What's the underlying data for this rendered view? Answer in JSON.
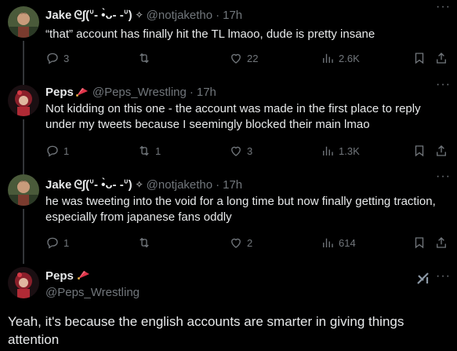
{
  "tweets": [
    {
      "name": "Jake",
      "name_deco": "ᘓ∫(ᐡ- •̀ᴗ- -ᐡ)",
      "badge": "✧",
      "handle": "@notjaketho",
      "time": "17h",
      "text": "“that” account has finally hit the TL lmaoo, dude is pretty insane",
      "replies": "3",
      "retweets": "",
      "likes": "22",
      "views": "2.6K"
    },
    {
      "name": "Peps",
      "name_deco": "",
      "badge": "",
      "handle": "@Peps_Wrestling",
      "time": "17h",
      "text": "Not kidding on this one - the account was made in the first place to reply under my tweets because I seemingly blocked their main lmao",
      "replies": "1",
      "retweets": "1",
      "likes": "3",
      "views": "1.3K"
    },
    {
      "name": "Jake",
      "name_deco": "ᘓ∫(ᐡ- •̀ᴗ- -ᐡ)",
      "badge": "✧",
      "handle": "@notjaketho",
      "time": "17h",
      "text": "he was tweeting into the void for a long time but now finally getting traction, especially from japanese fans oddly",
      "replies": "1",
      "retweets": "",
      "likes": "2",
      "views": "614"
    }
  ],
  "main_tweet": {
    "name": "Peps",
    "handle": "@Peps_Wrestling",
    "text": "Yeah, it's because the english accounts are smarter in giving things attention"
  },
  "icons": [
    "reply-icon",
    "retweet-icon",
    "like-icon",
    "views-icon",
    "bookmark-icon",
    "share-icon",
    "more-icon",
    "grok-icon"
  ],
  "colors": {
    "background": "#000000",
    "text": "#e7e9ea",
    "muted": "#71767b",
    "divider": "#2f3336"
  },
  "more_glyph": "···"
}
